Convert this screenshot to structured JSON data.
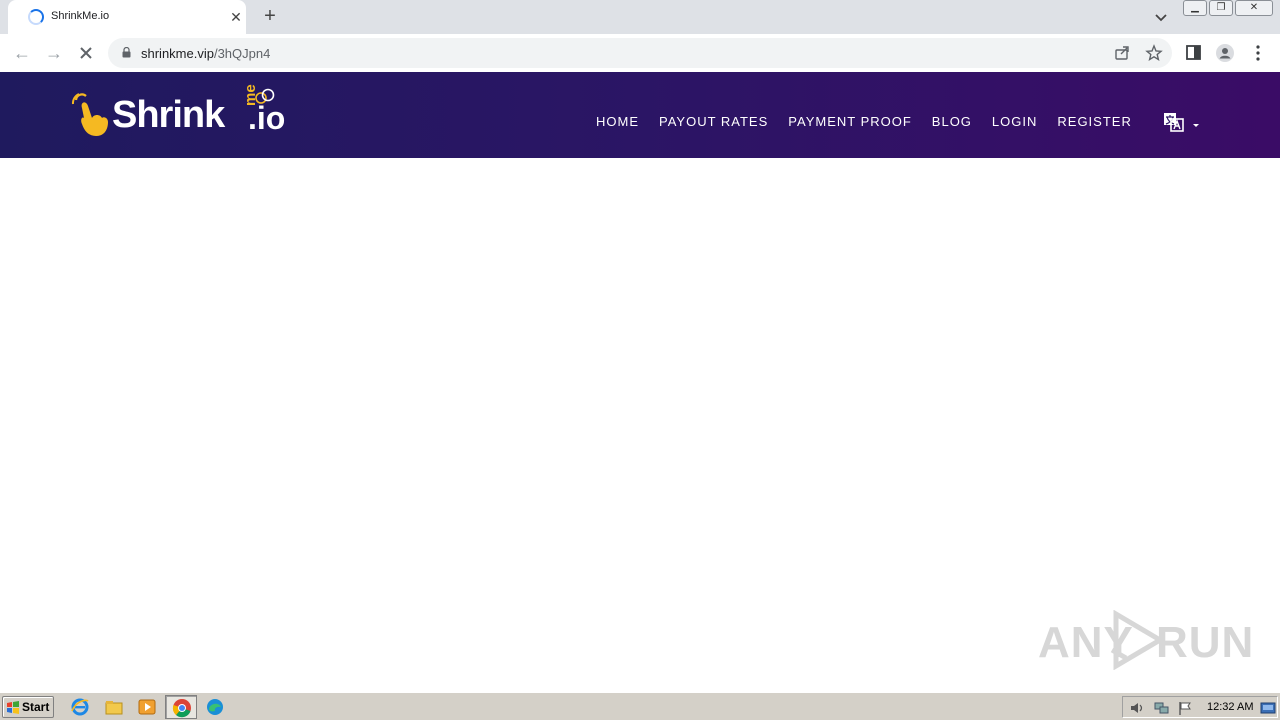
{
  "browser": {
    "tab_title": "ShrinkMe.io",
    "url_host": "shrinkme.vip",
    "url_path": "/3hQJpn4"
  },
  "site": {
    "logo_word": "Shrink",
    "logo_me": "me",
    "logo_io": ".io",
    "brand_colors": {
      "header_start": "#1f1a5e",
      "header_end": "#3a0c66",
      "accent": "#f5b922"
    },
    "nav": [
      {
        "label": "HOME"
      },
      {
        "label": "PAYOUT RATES"
      },
      {
        "label": "PAYMENT PROOF"
      },
      {
        "label": "BLOG"
      },
      {
        "label": "LOGIN"
      },
      {
        "label": "REGISTER"
      }
    ]
  },
  "watermark": {
    "left": "ANY",
    "right": "RUN"
  },
  "taskbar": {
    "start_label": "Start",
    "clock": "12:32 AM"
  }
}
